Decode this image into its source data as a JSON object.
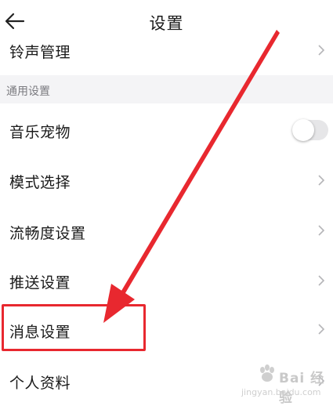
{
  "header": {
    "title": "设置"
  },
  "partial_row": {
    "label": "铃声管理"
  },
  "section": {
    "label": "通用设置"
  },
  "rows": [
    {
      "label": "音乐宠物",
      "control": "toggle",
      "toggle_on": false
    },
    {
      "label": "模式选择",
      "control": "chevron"
    },
    {
      "label": "流畅度设置",
      "control": "chevron"
    },
    {
      "label": "推送设置",
      "control": "chevron"
    },
    {
      "label": "消息设置",
      "control": "chevron"
    },
    {
      "label": "个人资料",
      "control": "chevron"
    }
  ],
  "annotation": {
    "color": "#e8282f",
    "highlighted_row": "消息设置"
  },
  "watermark": {
    "logo_text": "Bai 经验",
    "url": "jingyan.baidu.com"
  },
  "icons": {
    "back": "arrow-left-icon",
    "chevron": "chevron-right-icon"
  }
}
